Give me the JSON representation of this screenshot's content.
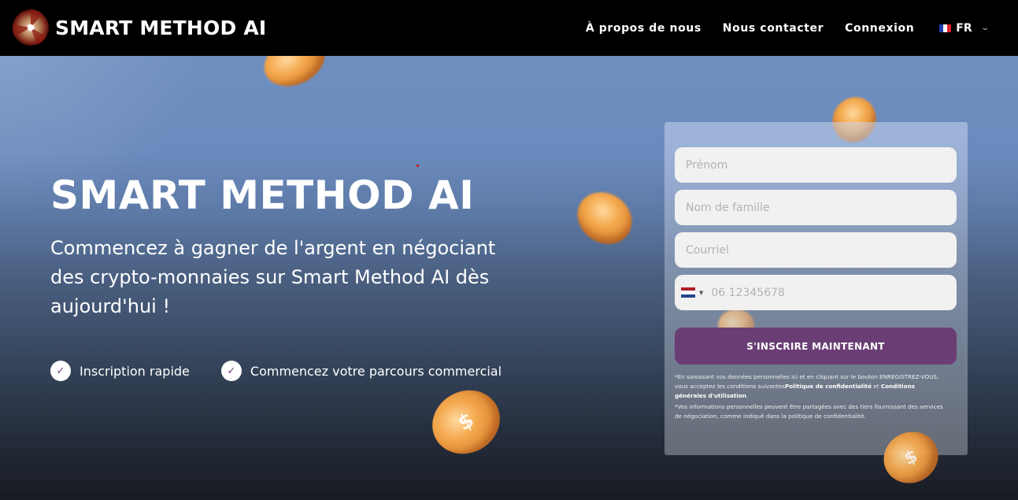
{
  "navbar": {
    "brand": "SMART METHOD AI",
    "links": [
      {
        "label": "À propos de nous"
      },
      {
        "label": "Nous contacter"
      },
      {
        "label": "Connexion"
      }
    ],
    "language": {
      "code": "FR",
      "flag": "france-flag"
    }
  },
  "hero": {
    "title": "SMART METHOD AI",
    "subtitle": "Commencez à gagner de l'argent en négociant des crypto-monnaies sur Smart Method AI dès aujourd'hui !",
    "features": [
      {
        "label": "Inscription rapide",
        "icon": "check-icon"
      },
      {
        "label": "Commencez votre parcours commercial",
        "icon": "check-icon"
      }
    ]
  },
  "form": {
    "first_name": {
      "placeholder": "Prénom",
      "value": ""
    },
    "last_name": {
      "placeholder": "Nom de famille",
      "value": ""
    },
    "email": {
      "placeholder": "Courriel",
      "value": ""
    },
    "phone": {
      "placeholder": "06 12345678",
      "value": "",
      "country_flag": "netherlands-flag"
    },
    "submit_label": "S'INSCRIRE MAINTENANT",
    "disclaimer1": {
      "prefix": "*En saisissant vos données personnelles ici et en cliquant sur le bouton ENREGISTREZ-VOUS, vous acceptez les conditions suivantes",
      "privacy_link": "Politique de confidentialité",
      "conjunction": " et ",
      "terms_link": "Conditions générales d'utilisation",
      "suffix": "."
    },
    "disclaimer2": "*Vos informations personnelles peuvent être partagées avec des tiers fournissant des services de négociation, comme indiqué dans la politique de confidentialité."
  },
  "colors": {
    "navbar_bg": "#000000",
    "accent_purple": "#6a3e75",
    "coin_orange": "#f4a94e",
    "hero_top": "#6f8fc0",
    "hero_bottom": "#181b22"
  }
}
